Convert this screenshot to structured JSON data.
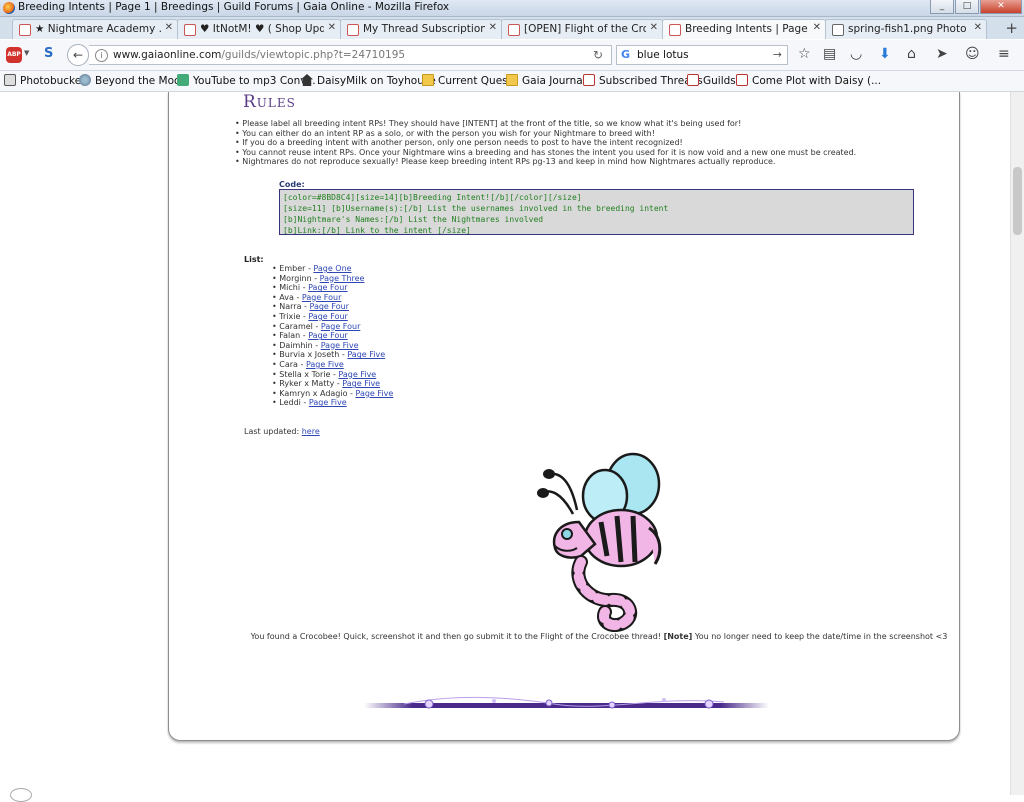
{
  "window": {
    "title": "Breeding Intents | Page 1 | Breedings | Guild Forums | Gaia Online - Mozilla Firefox"
  },
  "tabs": [
    {
      "label": "★ Nightmare Academy ...",
      "active": false
    },
    {
      "label": "♥ ItNotM! ♥ ( Shop Updat...",
      "active": false
    },
    {
      "label": "My Thread Subscriptions ...",
      "active": false
    },
    {
      "label": "[OPEN] Flight of the Croc...",
      "active": false
    },
    {
      "label": "Breeding Intents | Page 1 ...",
      "active": true
    },
    {
      "label": "spring-fish1.png Photo b...",
      "active": false
    }
  ],
  "nav": {
    "abp_label": "ABP",
    "s_label": "S",
    "url_host": "www.gaiaonline.com",
    "url_path": "/guilds/viewtopic.php?t=24710195",
    "search_value": "blue lotus"
  },
  "bookmarks": [
    {
      "label": "Photobucket",
      "icon": "camera-icon"
    },
    {
      "label": "Beyond the Moon",
      "icon": "globe-icon"
    },
    {
      "label": "YouTube to mp3 Conv...",
      "icon": "yt-icon"
    },
    {
      "label": "DaisyMilk on Toyhouse",
      "icon": "house-icon"
    },
    {
      "label": "Current Quests",
      "icon": "folder-icon"
    },
    {
      "label": "Gaia Journals",
      "icon": "folder-icon"
    },
    {
      "label": "Subscribed Threads",
      "icon": "gaia-icon"
    },
    {
      "label": "Guilds",
      "icon": "gaia-icon"
    },
    {
      "label": "Come Plot with Daisy (...",
      "icon": "gaia-icon"
    }
  ],
  "post": {
    "rules_heading": "Rules",
    "rules": [
      "Please label all breeding intent RPs! They should have [INTENT] at the front of the title, so we know what it's being used for!",
      "You can either do an intent RP as a solo, or with the person you wish for your Nightmare to breed with!",
      "If you do a breeding intent with another person, only one person needs to post to have the intent recognized!",
      "You cannot reuse intent RPs. Once your Nightmare wins a breeding and has stones the intent you used for it is now void and a new one must be created.",
      "Nightmares do not reproduce sexually! Please keep breeding intent RPs pg-13 and keep in mind how Nightmares actually reproduce."
    ],
    "code_label": "Code:",
    "code_lines": [
      "[color=#8BD8C4][size=14][b]Breeding Intent![/b][/color][/size]",
      "[size=11] [b]Username(s):[/b] List the usernames involved in the breeding intent",
      "[b]Nightmare's Names:[/b] List the Nightmares involved",
      "[b]Link:[/b] Link to the intent [/size]"
    ],
    "list_label": "List:",
    "entries": [
      {
        "name": "Ember",
        "page": "Page One"
      },
      {
        "name": "Morginn",
        "page": "Page Three"
      },
      {
        "name": "Michi",
        "page": "Page Four"
      },
      {
        "name": "Ava",
        "page": "Page Four"
      },
      {
        "name": "Narra",
        "page": "Page Four"
      },
      {
        "name": "Trixie",
        "page": "Page Four"
      },
      {
        "name": "Caramel",
        "page": "Page Four"
      },
      {
        "name": "Falan",
        "page": "Page Four"
      },
      {
        "name": "Daimhin",
        "page": "Page Five"
      },
      {
        "name": "Burvia x Joseth",
        "page": "Page Five"
      },
      {
        "name": "Cara",
        "page": "Page Five"
      },
      {
        "name": "Stella x Torie",
        "page": "Page Five"
      },
      {
        "name": "Ryker x Matty",
        "page": "Page Five"
      },
      {
        "name": "Kamryn x Adagio",
        "page": "Page Five"
      },
      {
        "name": "Leddi",
        "page": "Page Five"
      }
    ],
    "last_updated_label": "Last updated:",
    "last_updated_link": "here",
    "found_text_a": "You found a Crocobee! Quick, screenshot it and then go submit it to the Flight of the Crocobee thread!",
    "found_note": "[Note]",
    "found_text_b": "You no longer need to keep the date/time in the screenshot <3"
  },
  "colors": {
    "rules_heading": "#5a3d87",
    "code_text": "#228022",
    "link": "#2e47b5",
    "divider": "#4a2a8a"
  }
}
